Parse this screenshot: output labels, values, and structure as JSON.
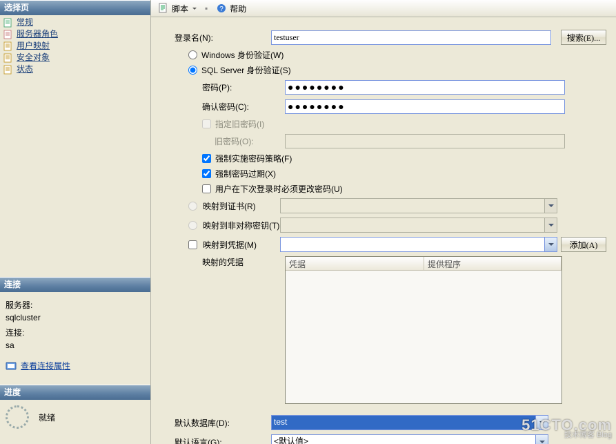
{
  "left": {
    "select_page_hdr": "选择页",
    "nav": [
      {
        "label": "常规"
      },
      {
        "label": "服务器角色"
      },
      {
        "label": "用户映射"
      },
      {
        "label": "安全对象"
      },
      {
        "label": "状态"
      }
    ],
    "conn_hdr": "连接",
    "server_label": "服务器:",
    "server_value": "sqlcluster",
    "conn_label": "连接:",
    "conn_value": "sa",
    "view_props": "查看连接属性",
    "progress_hdr": "进度",
    "progress_state": "就绪"
  },
  "toolbar": {
    "script": "脚本",
    "help": "帮助"
  },
  "form": {
    "login_label": "登录名(N):",
    "login_value": "testuser",
    "search_btn": "搜索(E)...",
    "radio_win": "Windows 身份验证(W)",
    "radio_sql": "SQL Server 身份验证(S)",
    "pwd_label": "密码(P):",
    "pwd_value": "●●●●●●●●",
    "pwd2_label": "确认密码(C):",
    "pwd2_value": "●●●●●●●●",
    "old_enable": "指定旧密码(I)",
    "old_label": "旧密码(O):",
    "policy": "强制实施密码策略(F)",
    "expire": "强制密码过期(X)",
    "change_next": "用户在下次登录时必须更改密码(U)",
    "map_cert": "映射到证书(R)",
    "map_asym": "映射到非对称密钥(T)",
    "map_cred": "映射到凭据(M)",
    "add_btn": "添加(A)",
    "cred_title": "映射的凭据",
    "cred_col1": "凭据",
    "cred_col2": "提供程序",
    "def_db_label": "默认数据库(D):",
    "def_db_value": "test",
    "def_lang_label": "默认语言(G):",
    "def_lang_value": "<默认值>"
  },
  "watermark": {
    "big": "51CTO.com",
    "small": "技术博客  Blog"
  }
}
